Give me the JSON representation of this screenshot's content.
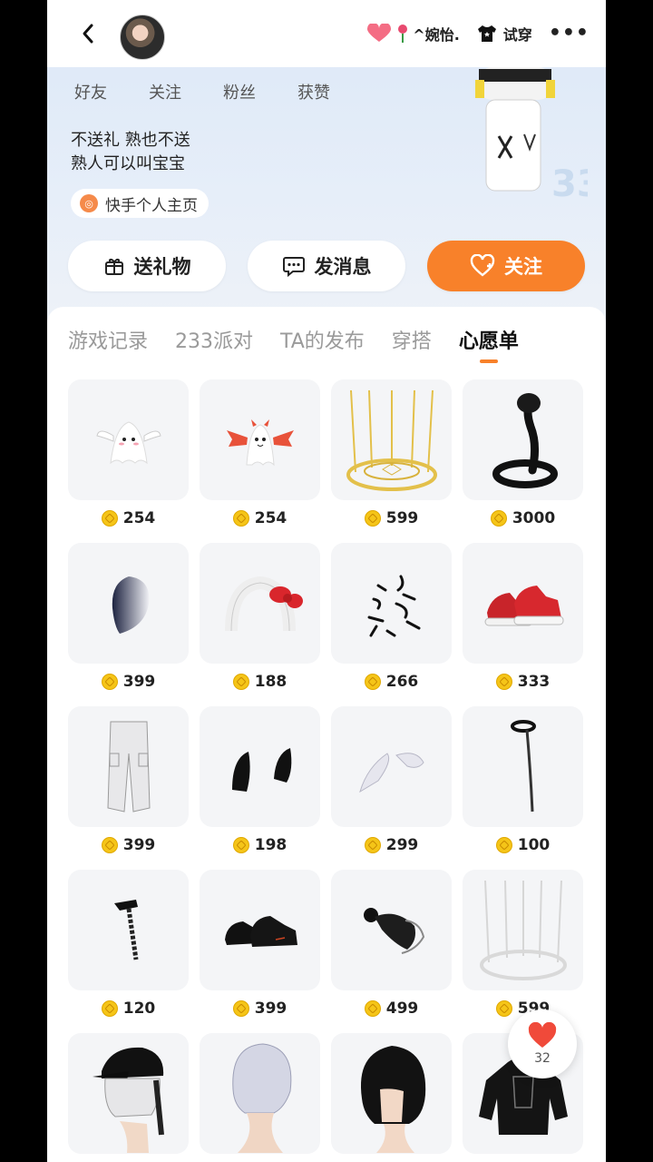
{
  "topbar": {
    "nickname": "^婉怡.",
    "try_on_label": "试穿",
    "more_label": "•••"
  },
  "stats": [
    {
      "label": "好友"
    },
    {
      "label": "关注"
    },
    {
      "label": "粉丝"
    },
    {
      "label": "获赞"
    }
  ],
  "bio": {
    "line1": "不送礼 熟也不送",
    "line2": "熟人可以叫宝宝"
  },
  "profile_chip": "快手个人主页",
  "actions": {
    "gift": "送礼物",
    "message": "发消息",
    "follow": "关注"
  },
  "tabs": [
    "游戏记录",
    "233派对",
    "TA的发布",
    "穿搭",
    "心愿单"
  ],
  "active_tab": 4,
  "wishlist": [
    {
      "icon": "ghost-angel-icon",
      "price": "254"
    },
    {
      "icon": "ghost-devil-icon",
      "price": "254"
    },
    {
      "icon": "golden-cage-icon",
      "price": "599"
    },
    {
      "icon": "black-snake-icon",
      "price": "3000"
    },
    {
      "icon": "gradient-hair-icon",
      "price": "399"
    },
    {
      "icon": "hello-kitty-headband-icon",
      "price": "188"
    },
    {
      "icon": "calligraphy-icon",
      "price": "266"
    },
    {
      "icon": "red-sneakers-icon",
      "price": "333"
    },
    {
      "icon": "cargo-pants-icon",
      "price": "399"
    },
    {
      "icon": "black-ears-icon",
      "price": "198"
    },
    {
      "icon": "white-ears-icon",
      "price": "299"
    },
    {
      "icon": "choker-chain-icon",
      "price": "100"
    },
    {
      "icon": "chain-earring-icon",
      "price": "120"
    },
    {
      "icon": "black-shoes-icon",
      "price": "399"
    },
    {
      "icon": "dark-hood-icon",
      "price": "499"
    },
    {
      "icon": "white-cage-icon",
      "price": "599"
    },
    {
      "icon": "cap-hair-icon",
      "price": ""
    },
    {
      "icon": "silver-hair-icon",
      "price": ""
    },
    {
      "icon": "black-hair-icon",
      "price": ""
    },
    {
      "icon": "black-hoodie-icon",
      "price": ""
    }
  ],
  "like_fab": {
    "count": "32"
  },
  "colors": {
    "accent": "#f8812a",
    "coin": "#f5c518"
  }
}
